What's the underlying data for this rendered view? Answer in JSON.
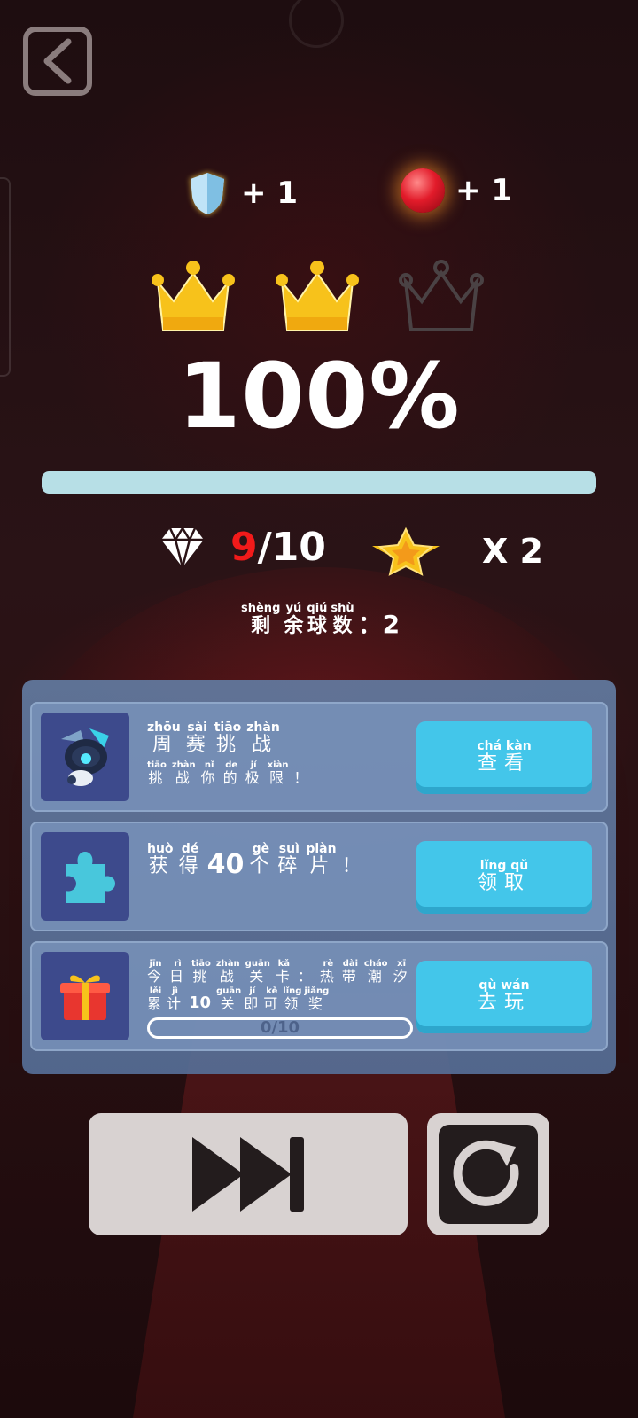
{
  "rewards": {
    "shield": "+ 1",
    "ball": "+ 1"
  },
  "crowns": {
    "earned": 2,
    "total": 3
  },
  "progress": {
    "text": "100%",
    "fraction": 1.0
  },
  "gems": {
    "collected": "9",
    "total": "/10"
  },
  "stars": {
    "multiplier": "X 2"
  },
  "remaining": {
    "chars": [
      {
        "py": "shèng",
        "hz": "剩"
      },
      {
        "py": "yú",
        "hz": "余"
      },
      {
        "py": "qiú",
        "hz": "球"
      },
      {
        "py": "shù",
        "hz": "数"
      }
    ],
    "value": "：2"
  },
  "rows": [
    {
      "title": [
        {
          "py": "zhōu",
          "hz": "周"
        },
        {
          "py": "sài",
          "hz": "赛"
        },
        {
          "py": "tiāo",
          "hz": "挑"
        },
        {
          "py": "zhàn",
          "hz": "战"
        }
      ],
      "subtitle": [
        {
          "py": "tiāo",
          "hz": "挑"
        },
        {
          "py": "zhàn",
          "hz": "战"
        },
        {
          "py": "nǐ",
          "hz": "你"
        },
        {
          "py": "de",
          "hz": "的"
        },
        {
          "py": "jí",
          "hz": "极"
        },
        {
          "py": "xiàn",
          "hz": "限"
        },
        {
          "py": "",
          "hz": "！"
        }
      ],
      "button": {
        "py": "chá  kàn",
        "hz": "查看"
      }
    },
    {
      "title_a": [
        {
          "py": "huò",
          "hz": "获"
        },
        {
          "py": "dé",
          "hz": "得"
        }
      ],
      "number": "40",
      "title_b": [
        {
          "py": "gè",
          "hz": "个"
        },
        {
          "py": "suì",
          "hz": "碎"
        },
        {
          "py": "piàn",
          "hz": "片"
        },
        {
          "py": "",
          "hz": "！"
        }
      ],
      "button": {
        "py": "lǐng  qǔ",
        "hz": "领取"
      }
    },
    {
      "title": [
        {
          "py": "jīn",
          "hz": "今"
        },
        {
          "py": "rì",
          "hz": "日"
        },
        {
          "py": "tiāo",
          "hz": "挑"
        },
        {
          "py": "zhàn",
          "hz": "战"
        },
        {
          "py": "guān",
          "hz": "关"
        },
        {
          "py": "kǎ",
          "hz": "卡"
        },
        {
          "py": "",
          "hz": "："
        },
        {
          "py": "rè",
          "hz": "热"
        },
        {
          "py": "dài",
          "hz": "带"
        },
        {
          "py": "cháo",
          "hz": "潮"
        },
        {
          "py": "xī",
          "hz": "汐"
        }
      ],
      "sub_a": [
        {
          "py": "lěi",
          "hz": "累"
        },
        {
          "py": "jì",
          "hz": "计"
        }
      ],
      "sub_number": "10",
      "sub_b": [
        {
          "py": "guān",
          "hz": "关"
        },
        {
          "py": "jí",
          "hz": "即"
        },
        {
          "py": "kě",
          "hz": "可"
        },
        {
          "py": "lǐng",
          "hz": "领"
        },
        {
          "py": "jiǎng",
          "hz": "奖"
        }
      ],
      "progress_text": "0/10",
      "button": {
        "py": "qù  wán",
        "hz": "去玩"
      }
    }
  ],
  "colors": {
    "gem_collected": "#f21a1a",
    "action_button": "#43c6ea",
    "progress_fill": "#b7dfe6",
    "panel": "#627aa0"
  },
  "icons": {
    "back": "back-arrow-icon",
    "shield": "shield-icon",
    "ball": "red-ball-icon",
    "crown": "crown-icon",
    "gem": "diamond-icon",
    "star": "winged-star-icon",
    "robot": "robot-icon",
    "puzzle": "puzzle-piece-icon",
    "gift": "gift-box-icon",
    "skip": "fast-forward-icon",
    "restart": "restart-icon"
  }
}
